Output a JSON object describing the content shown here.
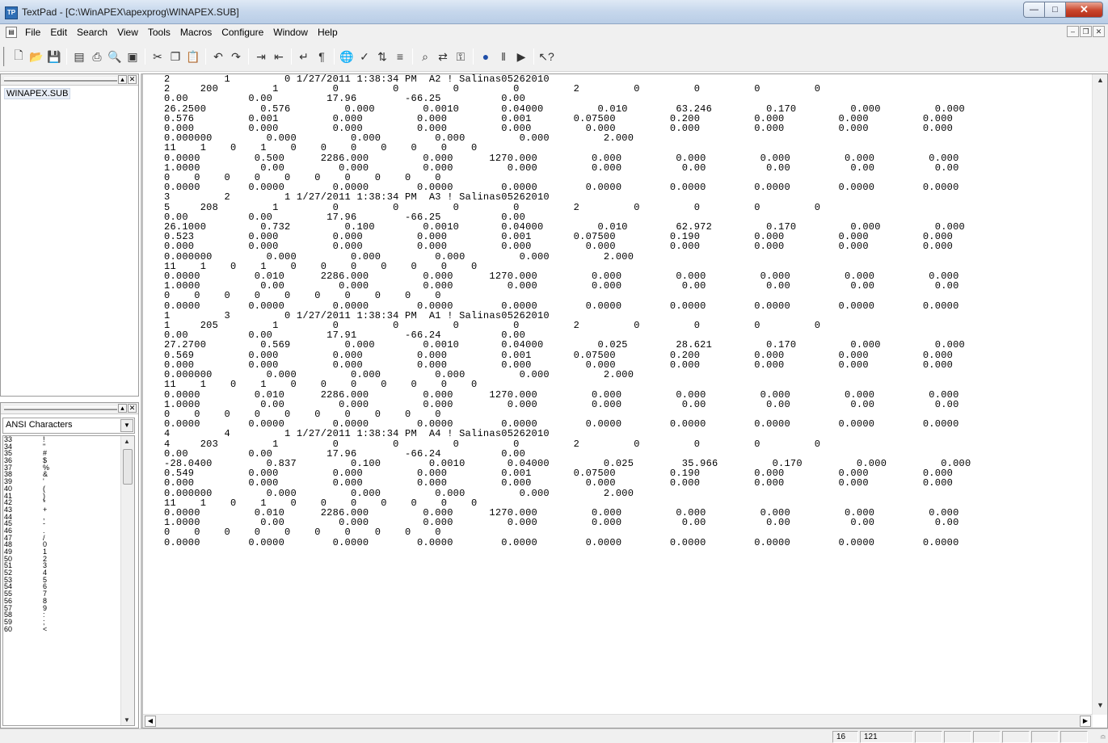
{
  "window": {
    "title": "TextPad - [C:\\WinAPEX\\apexprog\\WINAPEX.SUB]",
    "app_icon_label": "TP",
    "minimize_icon": "minimize-icon",
    "maximize_icon": "maximize-icon",
    "close_icon": "close-icon"
  },
  "menu": {
    "items": [
      "File",
      "Edit",
      "Search",
      "View",
      "Tools",
      "Macros",
      "Configure",
      "Window",
      "Help"
    ]
  },
  "toolbar": {
    "buttons": [
      "new-file-icon",
      "open-icon",
      "save-icon",
      "sep",
      "save-all-icon",
      "print-icon",
      "print-preview-icon",
      "manage-files-icon",
      "sep",
      "cut-icon",
      "copy-icon",
      "paste-icon",
      "sep",
      "undo-icon",
      "redo-icon",
      "sep",
      "indent-icon",
      "outdent-icon",
      "sep",
      "word-wrap-icon",
      "pilcrow-icon",
      "sep",
      "web-browser-icon",
      "spell-check-icon",
      "sort-icon",
      "compare-icon",
      "sep",
      "find-in-files-icon",
      "replace-icon",
      "record-macro-icon",
      "sep",
      "record-icon",
      "pause-icon",
      "play-icon",
      "sep",
      "help-pointer-icon"
    ]
  },
  "document_panel": {
    "files": [
      "WINAPEX.SUB"
    ]
  },
  "char_panel": {
    "charset": "ANSI Characters",
    "rows": [
      [
        "33",
        "!"
      ],
      [
        "34",
        "\""
      ],
      [
        "35",
        "#"
      ],
      [
        "36",
        "$"
      ],
      [
        "37",
        "%"
      ],
      [
        "38",
        "&"
      ],
      [
        "39",
        "'"
      ],
      [
        "40",
        "("
      ],
      [
        "41",
        ")"
      ],
      [
        "42",
        "*"
      ],
      [
        "43",
        "+"
      ],
      [
        "44",
        ","
      ],
      [
        "45",
        "-"
      ],
      [
        "46",
        "."
      ],
      [
        "47",
        "/"
      ],
      [
        "48",
        "0"
      ],
      [
        "49",
        "1"
      ],
      [
        "50",
        "2"
      ],
      [
        "51",
        "3"
      ],
      [
        "52",
        "4"
      ],
      [
        "53",
        "5"
      ],
      [
        "54",
        "6"
      ],
      [
        "55",
        "7"
      ],
      [
        "56",
        "8"
      ],
      [
        "57",
        "9"
      ],
      [
        "58",
        ":"
      ],
      [
        "59",
        ";"
      ],
      [
        "60",
        "<"
      ]
    ]
  },
  "editor": {
    "lines": [
      "2         1         0 1/27/2011 1:38:34 PM  A2 ! Salinas05262010",
      "2     200         1         0         0         0         0         2         0         0         0         0",
      "0.00          0.00         17.96        -66.25          0.00",
      "26.2500         0.576         0.000        0.0010       0.04000         0.010        63.246         0.170         0.000         0.000",
      "0.576         0.001         0.000         0.000         0.001       0.07500         0.200         0.000         0.000         0.000",
      "0.000         0.000         0.000         0.000         0.000         0.000         0.000         0.000         0.000         0.000",
      "0.000000         0.000         0.000         0.000         0.000         2.000",
      "11    1    0    1    0    0    0    0    0    0    0",
      "0.0000         0.500      2286.000         0.000      1270.000         0.000         0.000         0.000         0.000         0.000",
      "1.0000          0.00         0.000         0.000         0.000         0.000          0.00          0.00          0.00          0.00",
      "0    0    0    0    0    0    0    0    0    0",
      "0.0000        0.0000        0.0000        0.0000        0.0000        0.0000        0.0000        0.0000        0.0000        0.0000",
      "3         2         1 1/27/2011 1:38:34 PM  A3 ! Salinas05262010",
      "5     208         1         0         0         0         0         2         0         0         0         0",
      "0.00          0.00         17.96        -66.25          0.00",
      "26.1000         0.732         0.100        0.0010       0.04000         0.010        62.972         0.170         0.000         0.000",
      "0.523         0.000         0.000         0.000         0.001       0.07500         0.190         0.000         0.000         0.000",
      "0.000         0.000         0.000         0.000         0.000         0.000         0.000         0.000         0.000         0.000",
      "0.000000         0.000         0.000         0.000         0.000         2.000",
      "11    1    0    1    0    0    0    0    0    0    0",
      "0.0000         0.010      2286.000         0.000      1270.000         0.000         0.000         0.000         0.000         0.000",
      "1.0000          0.00         0.000         0.000         0.000         0.000          0.00          0.00          0.00          0.00",
      "0    0    0    0    0    0    0    0    0    0",
      "0.0000        0.0000        0.0000        0.0000        0.0000        0.0000        0.0000        0.0000        0.0000        0.0000",
      "1         3         0 1/27/2011 1:38:34 PM  A1 ! Salinas05262010",
      "1     205         1         0         0         0         0         2         0         0         0         0",
      "0.00          0.00         17.91        -66.24          0.00",
      "27.2700         0.569         0.000        0.0010       0.04000         0.025        28.621         0.170         0.000         0.000",
      "0.569         0.000         0.000         0.000         0.001       0.07500         0.200         0.000         0.000         0.000",
      "0.000         0.000         0.000         0.000         0.000         0.000         0.000         0.000         0.000         0.000",
      "0.000000         0.000         0.000         0.000         0.000         2.000",
      "11    1    0    1    0    0    0    0    0    0    0",
      "0.0000         0.010      2286.000         0.000      1270.000         0.000         0.000         0.000         0.000         0.000",
      "1.0000          0.00         0.000         0.000         0.000         0.000          0.00          0.00          0.00          0.00",
      "0    0    0    0    0    0    0    0    0    0",
      "0.0000        0.0000        0.0000        0.0000        0.0000        0.0000        0.0000        0.0000        0.0000        0.0000",
      "4         4         1 1/27/2011 1:38:34 PM  A4 ! Salinas05262010",
      "4     203         1         0         0         0         0         2         0         0         0         0",
      "0.00          0.00         17.96        -66.24          0.00",
      "-28.0400         0.837         0.100        0.0010       0.04000         0.025        35.966         0.170         0.000         0.000",
      "0.549         0.000         0.000         0.000         0.001       0.07500         0.190         0.000         0.000         0.000",
      "0.000         0.000         0.000         0.000         0.000         0.000         0.000         0.000         0.000         0.000",
      "0.000000         0.000         0.000         0.000         0.000         2.000",
      "11    1    0    1    0    0    0    0    0    0    0",
      "0.0000         0.010      2286.000         0.000      1270.000         0.000         0.000         0.000         0.000         0.000",
      "1.0000          0.00         0.000         0.000         0.000         0.000          0.00          0.00          0.00          0.00",
      "0    0    0    0    0    0    0    0    0    0",
      "0.0000        0.0000        0.0000        0.0000        0.0000        0.0000        0.0000        0.0000        0.0000        0.0000"
    ]
  },
  "status": {
    "line": "16",
    "column": "121"
  }
}
